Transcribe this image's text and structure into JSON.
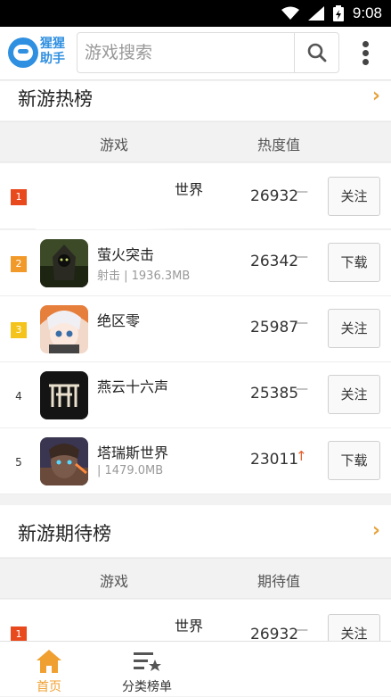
{
  "status": {
    "time": "9:08"
  },
  "app": {
    "logo_text": "猩猩助手",
    "search_placeholder": "游戏搜索"
  },
  "hot": {
    "title": "新游热榜",
    "col_game": "游戏",
    "col_value": "热度值",
    "rows": [
      {
        "rank": "1",
        "name": "世界",
        "sub": "",
        "value": "26932",
        "trend": "—",
        "action": "关注"
      },
      {
        "rank": "2",
        "name": "萤火突击",
        "sub": "射击 | 1936.3MB",
        "value": "26342",
        "trend": "—",
        "action": "下载"
      },
      {
        "rank": "3",
        "name": "绝区零",
        "sub": "",
        "value": "25987",
        "trend": "—",
        "action": "关注"
      },
      {
        "rank": "4",
        "name": "燕云十六声",
        "sub": "",
        "value": "25385",
        "trend": "—",
        "action": "关注"
      },
      {
        "rank": "5",
        "name": "塔瑞斯世界",
        "sub": "| 1479.0MB",
        "value": "23011",
        "trend": "↑",
        "action": "下载"
      }
    ]
  },
  "expect": {
    "title": "新游期待榜",
    "col_game": "游戏",
    "col_value": "期待值",
    "rows": [
      {
        "rank": "1",
        "name": "世界",
        "value": "26932",
        "trend": "—",
        "action": "关注"
      }
    ]
  },
  "tabs": [
    {
      "label": "首页"
    },
    {
      "label": "分类榜单"
    }
  ],
  "colors": {
    "accent": "#e6a23c",
    "brand": "#2f8fe0",
    "rank1": "#e8491d",
    "rank2": "#f19a2a",
    "rank3": "#f5c41c",
    "up": "#e6602c"
  }
}
